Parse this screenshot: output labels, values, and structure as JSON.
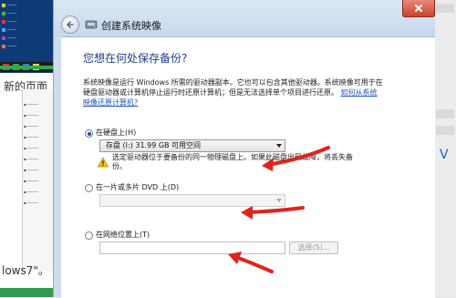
{
  "window": {
    "title": "创建系统映像"
  },
  "page": {
    "heading": "您想在何处保存备份?",
    "description": "系统映像是运行 Windows 所需的驱动器副本。它也可以包含其他驱动器。系统映像可用于在硬盘驱动器或计算机停止运行时还原计算机；但是无法选择单个项目进行还原。",
    "help_link": "如何从系统映像还原计算机?"
  },
  "options": {
    "hard_disk": {
      "label": "在硬盘上(H)",
      "selected": true,
      "dropdown_value": "存盘 (I:)  31.99 GB 可用空间",
      "warning": "选定驱动器位于要备份的同一物理磁盘上。如果此磁盘出现故障，将丢失备份。"
    },
    "dvd": {
      "label": "在一片或多片 DVD 上(D)",
      "selected": false,
      "dropdown_value": ""
    },
    "network": {
      "label": "在网络位置上(T)",
      "selected": false,
      "input_value": "",
      "browse_label": "选择(S)..."
    }
  },
  "background": {
    "left_top_text": "新的页面",
    "left_bottom_text": "lows7\"。",
    "right_glyph": "V"
  },
  "colors": {
    "heading": "#1e3f8a",
    "link": "#1f55b8",
    "annotation_arrow": "#e0241b",
    "titlebar": "#cfdcec"
  },
  "icons": [
    "back-arrow-icon",
    "system-image-icon",
    "close-icon",
    "warning-icon",
    "dropdown-arrow-icon"
  ]
}
